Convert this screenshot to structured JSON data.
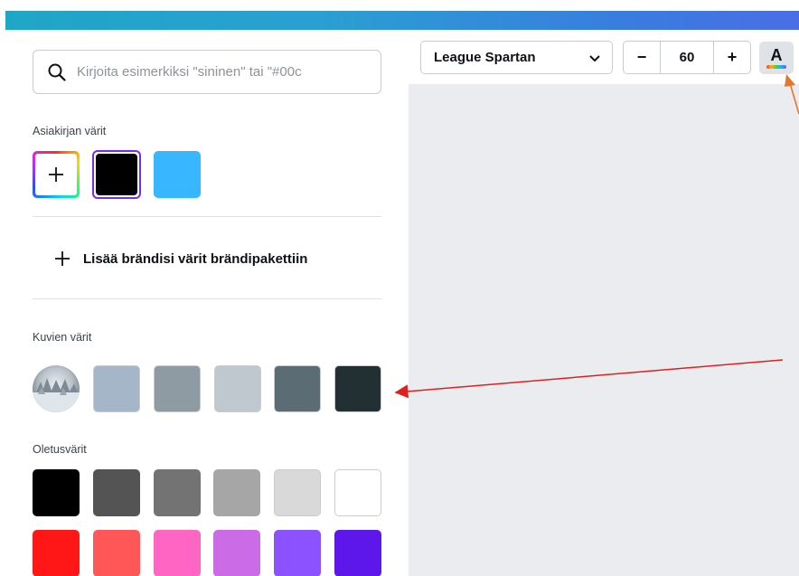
{
  "search": {
    "placeholder": "Kirjoita esimerkiksi \"sininen\" tai \"#00c"
  },
  "document_colors": {
    "label": "Asiakirjan värit",
    "add_icon": "plus-icon",
    "colors": [
      "#000000",
      "#38b6ff"
    ],
    "selected": "#000000",
    "selected_ring": "#7d2ae8"
  },
  "brand": {
    "label": "Lisää brändisi värit brändipakettiin",
    "icon": "plus-icon"
  },
  "image_colors": {
    "label": "Kuvien värit",
    "colors": [
      "#a6b6c9",
      "#8f9ba3",
      "#bfc7cf",
      "#5c6c74",
      "#222f33"
    ]
  },
  "default_colors": {
    "label": "Oletusvärit",
    "row1": [
      "#000000",
      "#545454",
      "#737373",
      "#a6a6a6",
      "#d9d9d9",
      "#ffffff"
    ],
    "row2": [
      "#ff1616",
      "#ff5757",
      "#ff66c4",
      "#cb6ce6",
      "#8c52ff",
      "#5e17eb"
    ]
  },
  "toolbar": {
    "font_name": "League Spartan",
    "font_size": "60",
    "minus": "−",
    "plus": "+",
    "text_color_glyph": "A"
  },
  "accent_colors": {
    "topbar_start": "#1fa6c7",
    "topbar_end": "#4a6ee6",
    "canvas_bg": "#ebecf0",
    "arrow_red": "#e0201c",
    "arrow_orange": "#e8762a"
  }
}
